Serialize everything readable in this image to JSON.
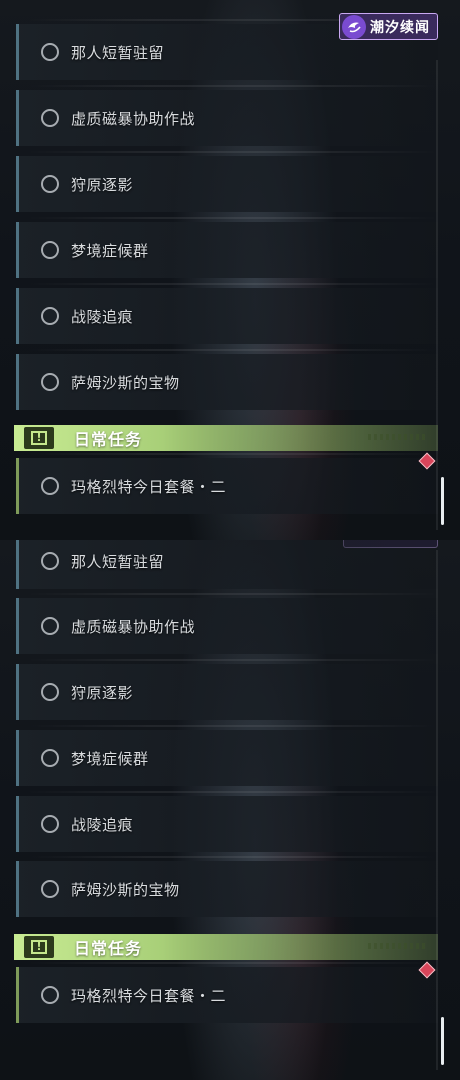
{
  "logo": {
    "text": "潮汐续闻"
  },
  "panels": [
    {
      "quests": [
        "那人短暂驻留",
        "虚质磁暴协助作战",
        "狩原逐影",
        "梦境症候群",
        "战陵追痕",
        "萨姆沙斯的宝物"
      ],
      "daily": {
        "title": "日常任务",
        "quests": [
          "玛格烈特今日套餐・二"
        ]
      }
    },
    {
      "quests": [
        "那人短暂驻留",
        "虚质磁暴协助作战",
        "狩原逐影",
        "梦境症候群",
        "战陵追痕",
        "萨姆沙斯的宝物"
      ],
      "daily": {
        "title": "日常任务",
        "quests": [
          "玛格烈特今日套餐・二"
        ]
      }
    }
  ],
  "icons": {
    "radio": "circle-outline-icon",
    "section": "exclamation-box-icon",
    "marker": "red-diamond-marker-icon",
    "logo": "tidal-logo-icon"
  },
  "colors": {
    "quest_border": "#4f7282",
    "daily_border": "#7f9b5a",
    "section_header": "#c9ec93",
    "marker": "#d8455a",
    "logo_bg": "#3a2a5c"
  }
}
